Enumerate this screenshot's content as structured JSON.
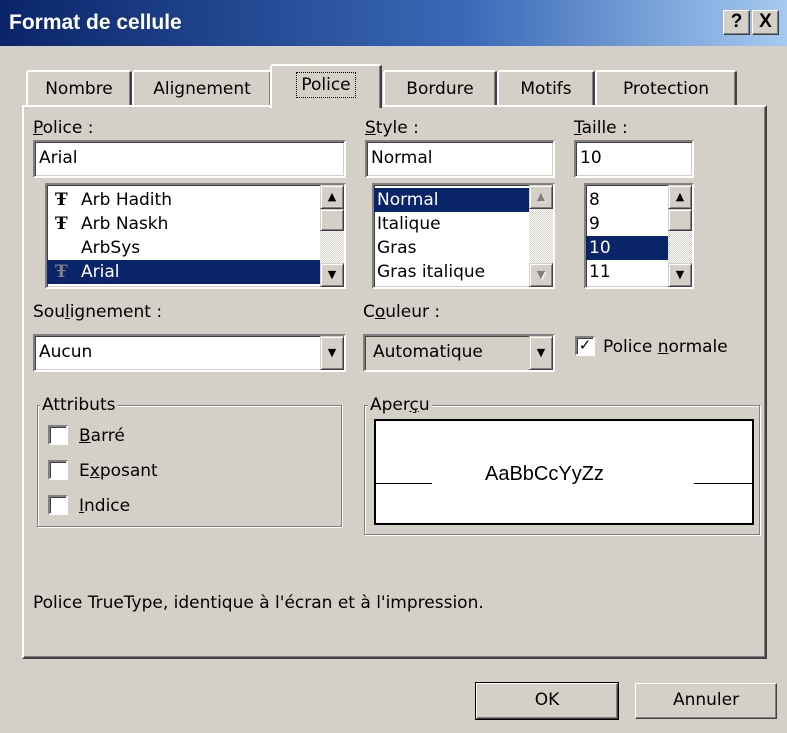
{
  "window": {
    "title": "Format de cellule",
    "help_label": "?",
    "close_label": "X"
  },
  "tabs": [
    {
      "label": "Nombre"
    },
    {
      "label": "Alignement"
    },
    {
      "label": "Police",
      "active": true
    },
    {
      "label": "Bordure"
    },
    {
      "label": "Motifs"
    },
    {
      "label": "Protection"
    }
  ],
  "font": {
    "label": "Police :",
    "value": "Arial",
    "items": [
      {
        "label": "Arb Hadith",
        "truetype": true
      },
      {
        "label": "Arb Naskh",
        "truetype": true
      },
      {
        "label": "ArbSys",
        "truetype": false
      },
      {
        "label": "Arial",
        "truetype": true,
        "selected": true
      }
    ]
  },
  "style": {
    "label": "Style :",
    "value": "Normal",
    "items": [
      {
        "label": "Normal",
        "selected": true
      },
      {
        "label": "Italique"
      },
      {
        "label": "Gras"
      },
      {
        "label": "Gras italique"
      }
    ]
  },
  "size": {
    "label": "Taille :",
    "value": "10",
    "items": [
      {
        "label": "8"
      },
      {
        "label": "9"
      },
      {
        "label": "10",
        "selected": true
      },
      {
        "label": "11"
      }
    ]
  },
  "underline": {
    "label": "Soulignement :",
    "value": "Aucun"
  },
  "color": {
    "label": "Couleur :",
    "value": "Automatique"
  },
  "normal_font": {
    "label": "Police normale",
    "checked": true
  },
  "attributes": {
    "legend": "Attributs",
    "items": [
      {
        "label": "Barré",
        "checked": false
      },
      {
        "label": "Exposant",
        "checked": false
      },
      {
        "label": "Indice",
        "checked": false
      }
    ]
  },
  "preview": {
    "legend": "Aperçu",
    "sample": "AaBbCcYyZz"
  },
  "description": "Police TrueType, identique à l'écran et à l'impression.",
  "buttons": {
    "ok": "OK",
    "cancel": "Annuler"
  },
  "colors": {
    "face": "#d4d0c8",
    "selection": "#0a246a",
    "title_start": "#0a246a",
    "title_end": "#a6caf0"
  },
  "icons": {
    "truetype": "truetype-font-icon",
    "checkmark": "checkmark-icon",
    "scroll_up": "arrow-up-icon",
    "scroll_down": "arrow-down-icon",
    "dropdown": "chevron-down-icon"
  }
}
